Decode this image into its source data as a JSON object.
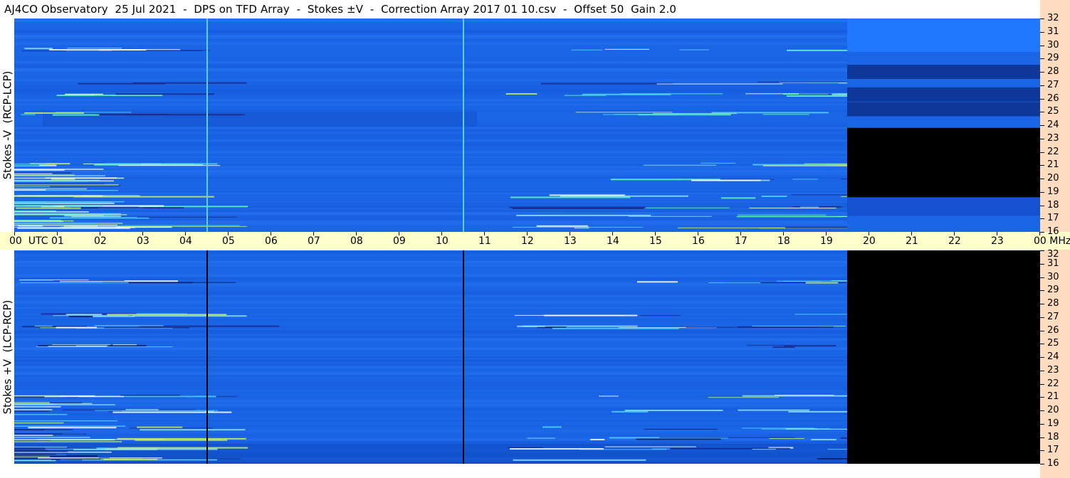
{
  "title": "AJ4CO Observatory  25 Jul 2021  -  DPS on TFD Array  -  Stokes ±V  -  Correction Array 2017 01 10.csv  -  Offset 50  Gain 2.0",
  "colors": {
    "background": "#ffffff",
    "spectrogram_base": "#1a64e6",
    "time_axis_bg": "#ffffcc",
    "freq_axis_bg": "#ffdcc0",
    "no_data": "#000000"
  },
  "chart_data": [
    {
      "type": "heatmap",
      "panel": "upper",
      "ylabel": "Stokes -V  (RCP-LCP)",
      "x_unit": "UTC",
      "y_unit": "MHz",
      "xlim": [
        0,
        24
      ],
      "ylim": [
        16,
        32
      ],
      "y_ticks": [
        "32",
        "31",
        "30",
        "29",
        "28",
        "27",
        "26",
        "25",
        "24",
        "23",
        "22",
        "21",
        "20",
        "19",
        "18",
        "17",
        "16"
      ],
      "data_end_utc": 19.5,
      "vertical_lines_utc": [
        4.5,
        10.5
      ],
      "vertical_line_color": "#5ad2ff",
      "emission_bands_mhz": [
        29.7,
        27.2,
        26.3,
        24.9,
        21.1,
        20.0,
        18.7,
        17.9,
        17.2,
        16.4
      ],
      "colorbar_mhz": {
        "bright": [
          32,
          29.5
        ],
        "dark_bands": [
          28,
          26.3,
          25.2,
          18
        ],
        "black": [
          16,
          23.8
        ]
      }
    },
    {
      "type": "heatmap",
      "panel": "lower",
      "ylabel": "Stokes +V  (LCP-RCP)",
      "x_unit": "UTC",
      "y_unit": "MHz",
      "xlim": [
        0,
        24
      ],
      "ylim": [
        16,
        32
      ],
      "y_ticks": [
        "32",
        "31",
        "30",
        "29",
        "28",
        "27",
        "26",
        "25",
        "24",
        "23",
        "22",
        "21",
        "20",
        "19",
        "18",
        "17",
        "16"
      ],
      "data_end_utc": 19.5,
      "vertical_lines_utc": [
        4.5,
        10.5
      ],
      "vertical_line_color": "#000000",
      "emission_bands_mhz": [
        29.7,
        27.2,
        26.3,
        24.9,
        21.1,
        20.0,
        18.7,
        17.9,
        17.2,
        16.4
      ]
    }
  ],
  "time_axis": {
    "labels": [
      "00",
      "01",
      "02",
      "03",
      "04",
      "05",
      "06",
      "07",
      "08",
      "09",
      "10",
      "11",
      "12",
      "13",
      "14",
      "15",
      "16",
      "17",
      "18",
      "19",
      "20",
      "21",
      "22",
      "23",
      "00"
    ],
    "first_suffix": "UTC",
    "last_suffix": "MHz"
  },
  "ylabels": {
    "upper": "Stokes -V  (RCP-LCP)",
    "lower": "Stokes +V  (LCP-RCP)"
  }
}
